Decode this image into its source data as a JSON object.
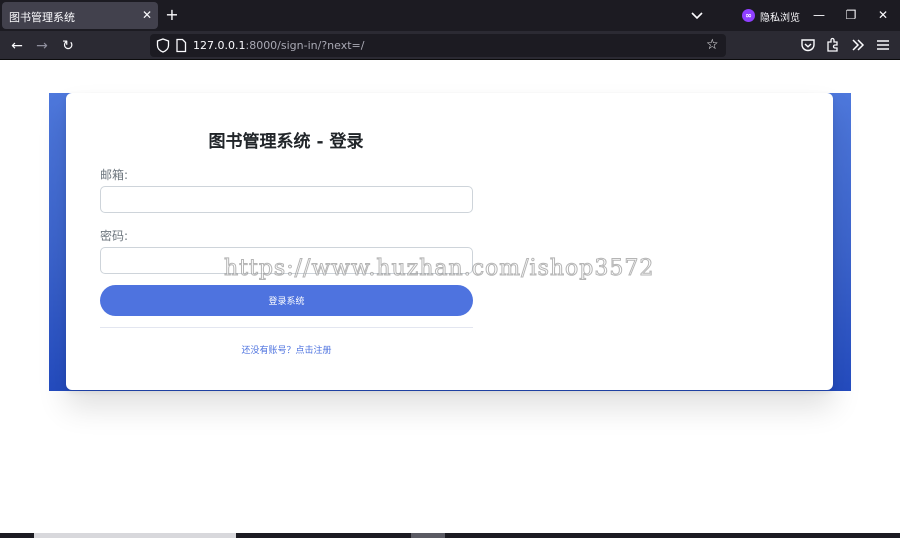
{
  "browser": {
    "tab_title": "图书管理系统",
    "tab_close": "✕",
    "new_tab": "+",
    "private_label": "隐私浏览",
    "private_logo": "∞",
    "url_host": "127.0.0.1",
    "url_rest": ":8000/sign-in/?next=/",
    "nav": {
      "back": "←",
      "forward": "→",
      "reload": "↻"
    },
    "window": {
      "minimize": "—",
      "restore": "❐",
      "close": "✕"
    },
    "bookmark_star": "☆"
  },
  "login": {
    "title": "图书管理系统 - 登录",
    "email_label": "邮箱:",
    "email_value": "",
    "password_label": "密码:",
    "password_value": "",
    "submit_label": "登录系统",
    "register_link": "还没有账号？点击注册"
  },
  "watermark": "https://www.huzhan.com/ishop3572",
  "colors": {
    "primary": "#4e73df",
    "gradient_top": "#4e78dc",
    "gradient_bottom": "#244cc0",
    "browser_dark": "#1c1b22",
    "private_purple": "#8f3fff"
  }
}
